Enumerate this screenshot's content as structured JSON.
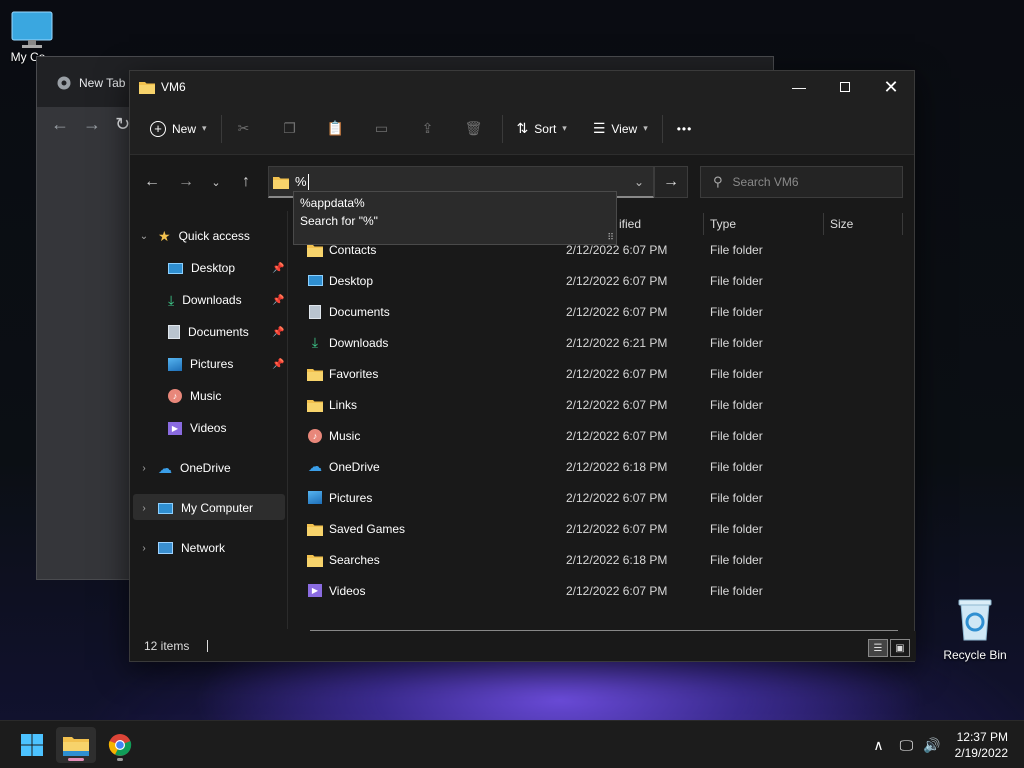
{
  "desktop": {
    "my_computer_label": "My Co",
    "recycle_bin_label": "Recycle Bin"
  },
  "browser": {
    "tab_title": "New Tab"
  },
  "explorer": {
    "title": "VM6",
    "toolbar": {
      "new_label": "New",
      "sort_label": "Sort",
      "view_label": "View",
      "more_label": "•••"
    },
    "address_value": "%",
    "search_placeholder": "Search VM6",
    "autocomplete": [
      "%appdata%",
      "Search for \"%\""
    ],
    "columns": {
      "modified": "ified",
      "type": "Type",
      "size": "Size"
    },
    "sidebar": {
      "quick_access": "Quick access",
      "quick_items": [
        {
          "label": "Desktop",
          "pinned": true
        },
        {
          "label": "Downloads",
          "pinned": true
        },
        {
          "label": "Documents",
          "pinned": true
        },
        {
          "label": "Pictures",
          "pinned": true
        },
        {
          "label": "Music",
          "pinned": false
        },
        {
          "label": "Videos",
          "pinned": false
        }
      ],
      "onedrive": "OneDrive",
      "my_computer": "My Computer",
      "network": "Network"
    },
    "files": [
      {
        "name": "Contacts",
        "date": "2/12/2022 6:07 PM",
        "type": "File folder",
        "icon": "folder-icon"
      },
      {
        "name": "Desktop",
        "date": "2/12/2022 6:07 PM",
        "type": "File folder",
        "icon": "desktop-icon"
      },
      {
        "name": "Documents",
        "date": "2/12/2022 6:07 PM",
        "type": "File folder",
        "icon": "documents-icon"
      },
      {
        "name": "Downloads",
        "date": "2/12/2022 6:21 PM",
        "type": "File folder",
        "icon": "downloads-icon"
      },
      {
        "name": "Favorites",
        "date": "2/12/2022 6:07 PM",
        "type": "File folder",
        "icon": "folder-icon"
      },
      {
        "name": "Links",
        "date": "2/12/2022 6:07 PM",
        "type": "File folder",
        "icon": "folder-icon"
      },
      {
        "name": "Music",
        "date": "2/12/2022 6:07 PM",
        "type": "File folder",
        "icon": "music-icon"
      },
      {
        "name": "OneDrive",
        "date": "2/12/2022 6:18 PM",
        "type": "File folder",
        "icon": "onedrive-icon"
      },
      {
        "name": "Pictures",
        "date": "2/12/2022 6:07 PM",
        "type": "File folder",
        "icon": "pictures-icon"
      },
      {
        "name": "Saved Games",
        "date": "2/12/2022 6:07 PM",
        "type": "File folder",
        "icon": "folder-icon"
      },
      {
        "name": "Searches",
        "date": "2/12/2022 6:18 PM",
        "type": "File folder",
        "icon": "folder-icon"
      },
      {
        "name": "Videos",
        "date": "2/12/2022 6:07 PM",
        "type": "File folder",
        "icon": "videos-icon"
      }
    ],
    "status_count": "12 items"
  },
  "taskbar": {
    "time": "12:37 PM",
    "date": "2/19/2022"
  },
  "colors": {
    "folder": "#f2c14e",
    "accent": "#4cc2ff",
    "explorer_bg": "#191919"
  }
}
